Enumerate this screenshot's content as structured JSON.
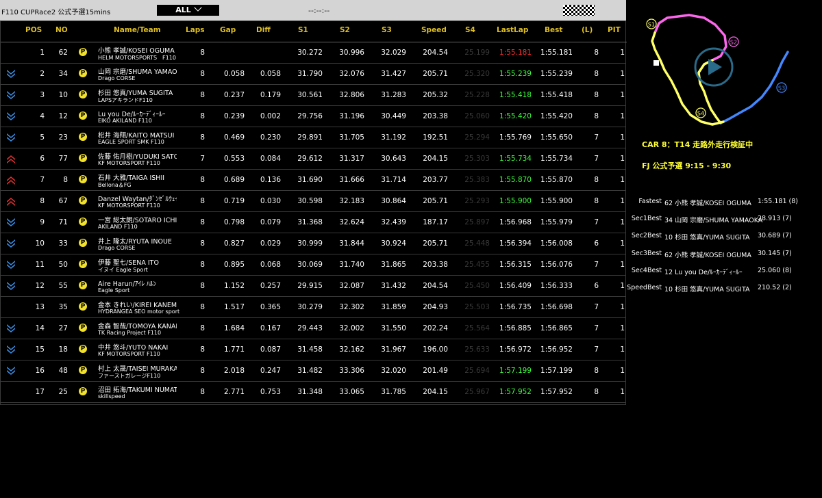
{
  "header": {
    "title": "F110 CUPRace2 公式予選15mins",
    "filter_label": "ALL",
    "clock": "--:--:--"
  },
  "columns": {
    "pos": "POS",
    "no": "NO",
    "name": "Name/Team",
    "laps": "Laps",
    "gap": "Gap",
    "diff": "Diff",
    "s1": "S1",
    "s2": "S2",
    "s3": "S3",
    "speed": "Speed",
    "s4": "S4",
    "lastlap": "LastLap",
    "best": "Best",
    "l": "(L)",
    "pit": "PIT"
  },
  "rows": [
    {
      "pos": "1",
      "no": "62",
      "arrow": "none",
      "pit": "P",
      "name": "小熊 孝誠/KOSEI OGUMA",
      "team": "HELM MOTORSPORTS　F110",
      "laps": "8",
      "gap": "",
      "diff": "",
      "s1": "30.272",
      "s2": "30.996",
      "s3": "32.029",
      "speed": "204.54",
      "s4": "25.199",
      "lastlap": "1:55.181",
      "lastlap_color": "red",
      "best": "1:55.181",
      "l": "8",
      "pit_count": "1"
    },
    {
      "pos": "2",
      "no": "34",
      "arrow": "down",
      "pit": "P",
      "name": "山岡 宗磨/SHUMA YAMAOKA",
      "team": "Drago CORSE",
      "laps": "8",
      "gap": "0.058",
      "diff": "0.058",
      "s1": "31.790",
      "s2": "32.076",
      "s3": "31.427",
      "speed": "205.71",
      "s4": "25.320",
      "lastlap": "1:55.239",
      "lastlap_color": "green",
      "best": "1:55.239",
      "l": "8",
      "pit_count": "1"
    },
    {
      "pos": "3",
      "no": "10",
      "arrow": "down",
      "pit": "P",
      "name": "杉田 悠真/YUMA SUGITA",
      "team": "LAPSアキランドF110",
      "laps": "8",
      "gap": "0.237",
      "diff": "0.179",
      "s1": "30.561",
      "s2": "32.806",
      "s3": "31.283",
      "speed": "205.32",
      "s4": "25.228",
      "lastlap": "1:55.418",
      "lastlap_color": "green",
      "best": "1:55.418",
      "l": "8",
      "pit_count": "1"
    },
    {
      "pos": "4",
      "no": "12",
      "arrow": "down",
      "pit": "P",
      "name": "Lu you De/ﾙｰｶｰﾃﾞｨｰﾙｰ",
      "team": "EIKO AKILAND F110",
      "laps": "8",
      "gap": "0.239",
      "diff": "0.002",
      "s1": "29.756",
      "s2": "31.196",
      "s3": "30.449",
      "speed": "203.38",
      "s4": "25.060",
      "lastlap": "1:55.420",
      "lastlap_color": "green",
      "best": "1:55.420",
      "l": "8",
      "pit_count": "1"
    },
    {
      "pos": "5",
      "no": "23",
      "arrow": "down",
      "pit": "P",
      "name": "松井 海翔/KAITO MATSUI",
      "team": "EAGLE SPORT SMK F110",
      "laps": "8",
      "gap": "0.469",
      "diff": "0.230",
      "s1": "29.891",
      "s2": "31.705",
      "s3": "31.192",
      "speed": "192.51",
      "s4": "25.294",
      "lastlap": "1:55.769",
      "lastlap_color": "white",
      "best": "1:55.650",
      "l": "7",
      "pit_count": "1"
    },
    {
      "pos": "6",
      "no": "77",
      "arrow": "up",
      "pit": "P",
      "name": "佐藤 佑月樹/YUDUKI SATO",
      "team": "KF MOTORSPORT F110",
      "laps": "7",
      "gap": "0.553",
      "diff": "0.084",
      "s1": "29.612",
      "s2": "31.317",
      "s3": "30.643",
      "speed": "204.15",
      "s4": "25.303",
      "lastlap": "1:55.734",
      "lastlap_color": "green",
      "best": "1:55.734",
      "l": "7",
      "pit_count": "1"
    },
    {
      "pos": "7",
      "no": "8",
      "arrow": "up",
      "pit": "P",
      "name": "石井 大雅/TAIGA ISHII",
      "team": "Bellona＆FG",
      "laps": "8",
      "gap": "0.689",
      "diff": "0.136",
      "s1": "31.690",
      "s2": "31.666",
      "s3": "31.714",
      "speed": "203.77",
      "s4": "25.383",
      "lastlap": "1:55.870",
      "lastlap_color": "green",
      "best": "1:55.870",
      "l": "8",
      "pit_count": "1"
    },
    {
      "pos": "8",
      "no": "67",
      "arrow": "up",
      "pit": "P",
      "name": "Danzel Waytan/ﾀﾞﾝｾﾞﾙｳｪｲﾀﾝ",
      "team": "KF MOTORSPORT F110",
      "laps": "8",
      "gap": "0.719",
      "diff": "0.030",
      "s1": "30.598",
      "s2": "32.183",
      "s3": "30.864",
      "speed": "205.71",
      "s4": "25.293",
      "lastlap": "1:55.900",
      "lastlap_color": "green",
      "best": "1:55.900",
      "l": "8",
      "pit_count": "1"
    },
    {
      "pos": "9",
      "no": "71",
      "arrow": "down",
      "pit": "P",
      "name": "一宮 総太朗/SOTARO ICHIMIYA",
      "team": "AKILAND F110",
      "laps": "8",
      "gap": "0.798",
      "diff": "0.079",
      "s1": "31.368",
      "s2": "32.624",
      "s3": "32.439",
      "speed": "187.17",
      "s4": "25.897",
      "lastlap": "1:56.968",
      "lastlap_color": "white",
      "best": "1:55.979",
      "l": "7",
      "pit_count": "1"
    },
    {
      "pos": "10",
      "no": "33",
      "arrow": "down",
      "pit": "P",
      "name": "井上 隆太/RYUTA INOUE",
      "team": "Drago CORSE",
      "laps": "8",
      "gap": "0.827",
      "diff": "0.029",
      "s1": "30.999",
      "s2": "31.844",
      "s3": "30.924",
      "speed": "205.71",
      "s4": "25.448",
      "lastlap": "1:56.394",
      "lastlap_color": "white",
      "best": "1:56.008",
      "l": "6",
      "pit_count": "1"
    },
    {
      "pos": "11",
      "no": "50",
      "arrow": "down",
      "pit": "P",
      "name": "伊藤 聖七/SENA ITO",
      "team": "イヌイ Eagle Sport",
      "laps": "8",
      "gap": "0.895",
      "diff": "0.068",
      "s1": "30.069",
      "s2": "31.740",
      "s3": "31.865",
      "speed": "203.38",
      "s4": "25.455",
      "lastlap": "1:56.315",
      "lastlap_color": "white",
      "best": "1:56.076",
      "l": "7",
      "pit_count": "1"
    },
    {
      "pos": "12",
      "no": "55",
      "arrow": "down",
      "pit": "P",
      "name": "Aire Harun/ｱｲﾚ ﾊﾙﾝ",
      "team": "Eagle Sport",
      "laps": "8",
      "gap": "1.152",
      "diff": "0.257",
      "s1": "29.915",
      "s2": "32.087",
      "s3": "31.432",
      "speed": "204.54",
      "s4": "25.450",
      "lastlap": "1:56.409",
      "lastlap_color": "white",
      "best": "1:56.333",
      "l": "6",
      "pit_count": "1"
    },
    {
      "pos": "13",
      "no": "35",
      "arrow": "none",
      "pit": "P",
      "name": "金本 きれい/KIREI KANEMOTO",
      "team": "HYDRANGEA SEO motor sport",
      "laps": "8",
      "gap": "1.517",
      "diff": "0.365",
      "s1": "30.279",
      "s2": "32.302",
      "s3": "31.859",
      "speed": "204.93",
      "s4": "25.503",
      "lastlap": "1:56.735",
      "lastlap_color": "white",
      "best": "1:56.698",
      "l": "7",
      "pit_count": "1"
    },
    {
      "pos": "14",
      "no": "27",
      "arrow": "down",
      "pit": "P",
      "name": "金森 智哉/TOMOYA KANAMORI",
      "team": "TK Racing Project F110",
      "laps": "8",
      "gap": "1.684",
      "diff": "0.167",
      "s1": "29.443",
      "s2": "32.002",
      "s3": "31.550",
      "speed": "202.24",
      "s4": "25.564",
      "lastlap": "1:56.885",
      "lastlap_color": "white",
      "best": "1:56.865",
      "l": "7",
      "pit_count": "1"
    },
    {
      "pos": "15",
      "no": "18",
      "arrow": "down",
      "pit": "P",
      "name": "中井 悠斗/YUTO NAKAI",
      "team": "KF MOTORSPORT F110",
      "laps": "8",
      "gap": "1.771",
      "diff": "0.087",
      "s1": "31.458",
      "s2": "32.162",
      "s3": "31.967",
      "speed": "196.00",
      "s4": "25.633",
      "lastlap": "1:56.972",
      "lastlap_color": "white",
      "best": "1:56.952",
      "l": "7",
      "pit_count": "1"
    },
    {
      "pos": "16",
      "no": "48",
      "arrow": "down",
      "pit": "P",
      "name": "村上 太晟/TAISEI MURAKAMI",
      "team": "ファーストガレージF110",
      "laps": "8",
      "gap": "2.018",
      "diff": "0.247",
      "s1": "31.482",
      "s2": "33.306",
      "s3": "32.020",
      "speed": "201.49",
      "s4": "25.694",
      "lastlap": "1:57.199",
      "lastlap_color": "green",
      "best": "1:57.199",
      "l": "8",
      "pit_count": "1"
    },
    {
      "pos": "17",
      "no": "25",
      "arrow": "none",
      "pit": "P",
      "name": "沼田 拓海/TAKUMI NUMATA",
      "team": "skillspeed",
      "laps": "8",
      "gap": "2.771",
      "diff": "0.753",
      "s1": "31.348",
      "s2": "33.065",
      "s3": "31.785",
      "speed": "204.15",
      "s4": "25.967",
      "lastlap": "1:57.952",
      "lastlap_color": "green",
      "best": "1:57.952",
      "l": "8",
      "pit_count": "1"
    }
  ],
  "track": {
    "labels": [
      "S1",
      "S2",
      "S3",
      "S4"
    ],
    "colors": {
      "s1": "#ff66ee",
      "s2": "#ffff66",
      "s3": "#4488ff",
      "s4": "#ffff66",
      "play": "#2a6a8a"
    }
  },
  "messages": [
    "CAR 8：T14 走路外走行検証中",
    "FJ 公式予選 9:15 - 9:30"
  ],
  "bests": [
    {
      "label": "Fastest",
      "driver": "62 小熊 孝誠/KOSEI OGUMA",
      "value": "1:55.181 (8)"
    },
    {
      "label": "Sec1Best",
      "driver": "34 山岡 宗磨/SHUMA YAMAOKA",
      "value": "28.913 (7)"
    },
    {
      "label": "Sec2Best",
      "driver": "10 杉田 悠真/YUMA SUGITA",
      "value": "30.689 (7)"
    },
    {
      "label": "Sec3Best",
      "driver": "62 小熊 孝誠/KOSEI OGUMA",
      "value": "30.145 (7)"
    },
    {
      "label": "Sec4Best",
      "driver": "12 Lu you De/ﾙｰｶｰﾃﾞｨｰﾙｰ",
      "value": "25.060 (8)"
    },
    {
      "label": "SpeedBest",
      "driver": "10 杉田 悠真/YUMA SUGITA",
      "value": "210.52 (2)"
    }
  ]
}
